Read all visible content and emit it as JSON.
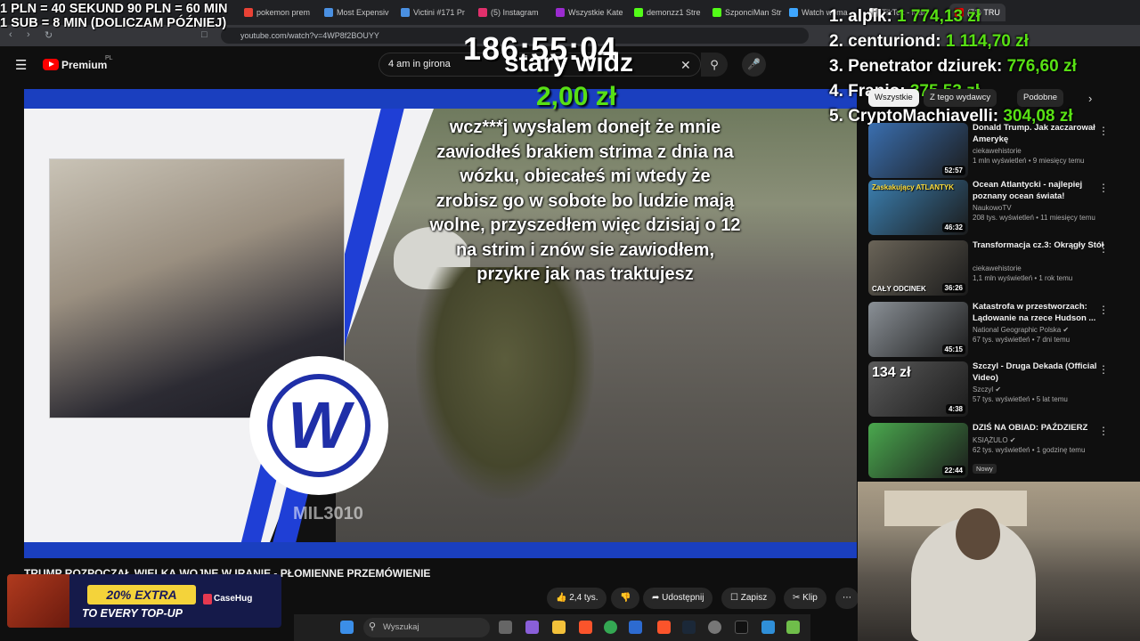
{
  "browser": {
    "tabs": [
      {
        "label": "pokemon prem",
        "color": "#e94235"
      },
      {
        "label": "Most Expensiv",
        "color": "#4a90e2"
      },
      {
        "label": "Victini #171 Pr",
        "color": "#4a90e2"
      },
      {
        "label": "(5) Instagram",
        "color": "#e1306c"
      },
      {
        "label": "Wszystkie Kate",
        "color": "#9b2bd0"
      },
      {
        "label": "demonzz1 Stre",
        "color": "#53fc18"
      },
      {
        "label": "SzponciMan Str",
        "color": "#53fc18"
      },
      {
        "label": "Watch woma",
        "color": "#3ea6ff"
      },
      {
        "label": "TikTok - Mak",
        "color": "#ffffff"
      },
      {
        "label": "(71) TRU",
        "color": "#ff0000"
      }
    ],
    "url": "youtube.com/watch?v=4WP8f2BOUYY"
  },
  "youtube": {
    "brand": "Premium",
    "region": "PL",
    "search_value": "4 am in girona"
  },
  "overlay": {
    "rate_line1": "1 PLN = 40 SEKUND 90 PLN = 60 MIN",
    "rate_line2": "1 SUB = 8 MIN (DOLICZAM PÓŹNIEJ)",
    "timer": "186:55:04",
    "donor": "stary widz",
    "donation_amount": "2,00 zł",
    "donation_message": "wcz***j wysłalem donejt że mnie zawiodłeś brakiem strima z dnia na wózku, obiecałeś mi wtedy że zrobisz go w sobote bo ludzie mają wolne, przyszedłem więc dzisiaj o 12 na strim i znów sie zawiodłem, przykre jak nas traktujesz",
    "leaderboard": [
      {
        "rank": "1.",
        "name": "alpik:",
        "amount": "1 774,13 zł"
      },
      {
        "rank": "2.",
        "name": "centuriond:",
        "amount": "1 114,70 zł"
      },
      {
        "rank": "3.",
        "name": "Penetrator dziurek:",
        "amount": "776,60 zł"
      },
      {
        "rank": "4.",
        "name": "Franio:",
        "amount": "375,53 zł"
      },
      {
        "rank": "5.",
        "name": "CryptoMachiavelli:",
        "amount": "304,08 zł"
      }
    ]
  },
  "video": {
    "watermark": "MIL3010",
    "title": "TRUMP ROZPOCZĄŁ WIELKĄ WOJNĘ W IRANIE - PŁOMIENNE PRZEMÓWIENIE",
    "likes": "2,4 tys.",
    "share": "Udostępnij",
    "save": "Zapisz",
    "clip": "Klip"
  },
  "chips": [
    "Wszystkie",
    "Z tego wydawcy",
    "Podobne"
  ],
  "recommendations": [
    {
      "title": "Donald Trump. Jak zaczarował Amerykę",
      "channel": "ciekawehistorie",
      "meta": "1 mln wyświetleń • 9 miesięcy temu",
      "duration": "52:57",
      "thumb": "#3a6fb0",
      "verified": false,
      "is_new": false
    },
    {
      "title": "Ocean Atlantycki - najlepiej poznany ocean świata!",
      "channel": "NaukowoTV",
      "meta": "208 tys. wyświetleń • 11 miesięcy temu",
      "duration": "46:32",
      "thumb": "#3b7fb0",
      "verified": false,
      "is_new": false
    },
    {
      "title": "Transformacja cz.3: Okrągły Stół",
      "channel": "ciekawehistorie",
      "meta": "1,1 mln wyświetleń • 1 rok temu",
      "duration": "36:26",
      "thumb": "#6a6458",
      "verified": false,
      "is_new": false
    },
    {
      "title": "Katastrofa w przestworzach: Lądowanie na rzece Hudson ...",
      "channel": "National Geographic Polska",
      "meta": "67 tys. wyświetleń • 7 dni temu",
      "duration": "45:15",
      "thumb": "#8a9096",
      "verified": true,
      "is_new": false
    },
    {
      "title": "Szczyl - Druga Dekada (Official Video)",
      "channel": "Szczyl",
      "meta": "57 tys. wyświetleń • 5 lat temu",
      "duration": "4:38",
      "thumb": "#5a5a5a",
      "verified": true,
      "is_new": false
    },
    {
      "title": "DZIŚ NA OBIAD: PAŹDZIERZ",
      "channel": "KSIĄŻULO",
      "meta": "62 tys. wyświetleń • 1 godzinę temu",
      "duration": "22:44",
      "thumb": "#4aa84e",
      "verified": true,
      "is_new": true,
      "new_label": "Nowy"
    }
  ],
  "thumb_text": {
    "rec1_badge": "Zaskakujący ATLANTYK",
    "rec3_badge": "CAŁY ODCINEK",
    "rec5_badge": "134 zł"
  },
  "taskbar": {
    "search_placeholder": "Wyszukaj"
  },
  "ad": {
    "headline": "20% EXTRA",
    "subline": "TO EVERY TOP-UP",
    "brand": "CaseHug"
  }
}
